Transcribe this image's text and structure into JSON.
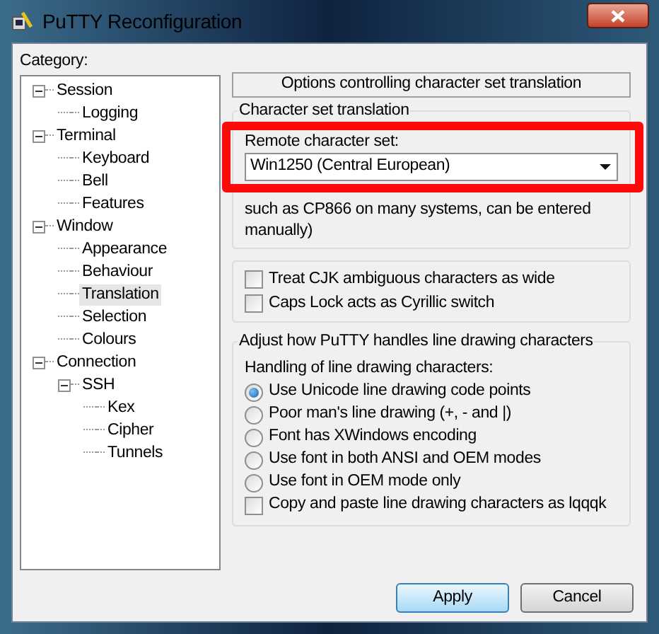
{
  "window": {
    "title": "PuTTY Reconfiguration"
  },
  "category_label": "Category:",
  "tree": [
    {
      "label": "Session",
      "expanded": true,
      "selected": false,
      "children": [
        {
          "label": "Logging",
          "selected": false
        }
      ]
    },
    {
      "label": "Terminal",
      "expanded": true,
      "selected": false,
      "children": [
        {
          "label": "Keyboard",
          "selected": false
        },
        {
          "label": "Bell",
          "selected": false
        },
        {
          "label": "Features",
          "selected": false
        }
      ]
    },
    {
      "label": "Window",
      "expanded": true,
      "selected": false,
      "children": [
        {
          "label": "Appearance",
          "selected": false
        },
        {
          "label": "Behaviour",
          "selected": false
        },
        {
          "label": "Translation",
          "selected": true
        },
        {
          "label": "Selection",
          "selected": false
        },
        {
          "label": "Colours",
          "selected": false
        }
      ]
    },
    {
      "label": "Connection",
      "expanded": true,
      "selected": false,
      "children": [
        {
          "label": "SSH",
          "expanded": true,
          "selected": false,
          "children": [
            {
              "label": "Kex",
              "selected": false
            },
            {
              "label": "Cipher",
              "selected": false
            },
            {
              "label": "Tunnels",
              "selected": false
            }
          ]
        }
      ]
    }
  ],
  "panel_header": "Options controlling character set translation",
  "charset_group": {
    "title": "Character set translation",
    "field_label": "Remote character set:",
    "value": "Win1250 (Central European)",
    "help": "such as CP866 on many systems, can be entered manually)"
  },
  "checkboxes": [
    {
      "label": "Treat CJK ambiguous characters as wide",
      "checked": false
    },
    {
      "label": "Caps Lock acts as Cyrillic switch",
      "checked": false
    }
  ],
  "line_group": {
    "title": "Adjust how PuTTY handles line drawing characters",
    "subtitle": "Handling of line drawing characters:",
    "options": [
      {
        "label": "Use Unicode line drawing code points",
        "selected": true
      },
      {
        "label": "Poor man's line drawing (+, - and |)",
        "selected": false
      },
      {
        "label": "Font has XWindows encoding",
        "selected": false
      },
      {
        "label": "Use font in both ANSI and OEM modes",
        "selected": false
      },
      {
        "label": "Use font in OEM mode only",
        "selected": false
      }
    ],
    "copy_checkbox": {
      "label": "Copy and paste line drawing characters as lqqqk",
      "checked": false
    }
  },
  "buttons": [
    {
      "label": "Apply",
      "default": true
    },
    {
      "label": "Cancel",
      "default": false
    }
  ]
}
